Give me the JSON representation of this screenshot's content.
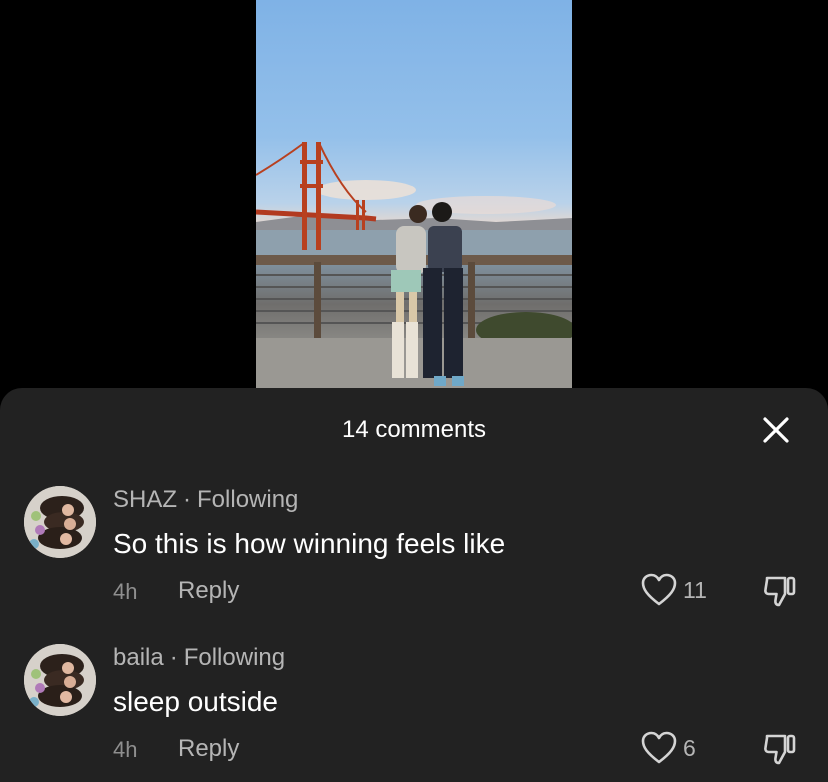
{
  "sheet": {
    "title": "14 comments"
  },
  "comments": [
    {
      "username": "SHAZ",
      "separator": "·",
      "relation": "Following",
      "text": "So this is how winning feels like",
      "time": "4h",
      "reply_label": "Reply",
      "likes": "11"
    },
    {
      "username": "baila",
      "separator": "·",
      "relation": "Following",
      "text": "sleep outside",
      "time": "4h",
      "reply_label": "Reply",
      "likes": "6"
    }
  ],
  "icons": {
    "close": "close-icon",
    "like": "heart-icon",
    "dislike": "thumbs-down-icon"
  },
  "colors": {
    "sheet_background": "#222222",
    "secondary_text": "#b5b5b5"
  }
}
